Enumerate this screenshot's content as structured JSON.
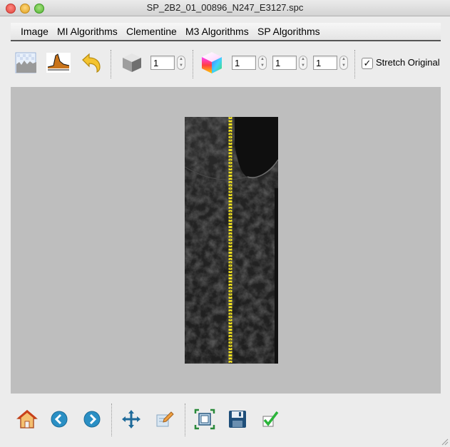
{
  "window": {
    "title": "SP_2B2_01_00896_N247_E3127.spc"
  },
  "menu": {
    "items": [
      "Image",
      "MI Algorithms",
      "Clementine",
      "M3 Algorithms",
      "SP Algorithms"
    ]
  },
  "toolbar": {
    "icons": [
      "image-view-icon",
      "histogram-icon",
      "undo-icon",
      "grayscale-cube-icon",
      "color-cube-icon"
    ],
    "gray_band": "1",
    "rgb_bands": [
      "1",
      "1",
      "1"
    ],
    "stretch_label": "Stretch Original",
    "stretch_checked": true
  },
  "bottom": {
    "icons": [
      "home-icon",
      "back-icon",
      "forward-icon",
      "pan-icon",
      "edit-icon",
      "zoom-fit-icon",
      "save-icon",
      "apply-icon"
    ]
  },
  "colors": {
    "background": "#ececec",
    "viewport": "#bebebe",
    "profile_line": "#f0e020"
  }
}
